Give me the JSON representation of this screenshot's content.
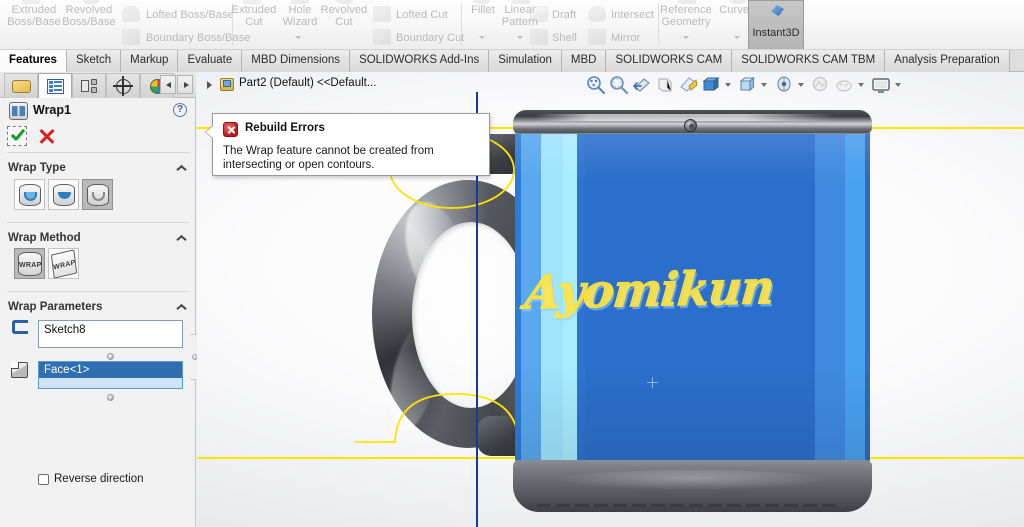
{
  "ribbon": {
    "groups": [
      {
        "name": "features-boss",
        "commands": [
          {
            "label": "Extruded\nBoss/Base",
            "icon": "extruded-boss-icon"
          },
          {
            "label": "Revolved\nBoss/Base",
            "icon": "revolved-boss-icon"
          },
          {
            "label": "Lofted Boss/Base",
            "icon": "lofted-boss-icon"
          },
          {
            "label": "Boundary Boss/Base",
            "icon": "boundary-boss-icon"
          }
        ]
      },
      {
        "name": "features-cut",
        "commands": [
          {
            "label": "Extruded\nCut",
            "icon": "extruded-cut-icon"
          },
          {
            "label": "Hole\nWizard",
            "icon": "hole-wizard-icon"
          },
          {
            "label": "Revolved\nCut",
            "icon": "revolved-cut-icon"
          },
          {
            "label": "Lofted Cut",
            "icon": "lofted-cut-icon"
          },
          {
            "label": "Boundary Cut",
            "icon": "boundary-cut-icon"
          }
        ]
      },
      {
        "name": "features-modify",
        "commands": [
          {
            "label": "Fillet",
            "icon": "fillet-icon"
          },
          {
            "label": "Linear\nPattern",
            "icon": "linear-pattern-icon"
          },
          {
            "label": "Draft",
            "icon": "draft-icon"
          },
          {
            "label": "Intersect",
            "icon": "intersect-icon"
          },
          {
            "label": "Shell",
            "icon": "shell-icon"
          },
          {
            "label": "Mirror",
            "icon": "mirror-icon"
          }
        ]
      },
      {
        "name": "features-reference",
        "commands": [
          {
            "label": "Reference\nGeometry",
            "icon": "reference-geometry-icon"
          },
          {
            "label": "Curves",
            "icon": "curves-icon"
          }
        ]
      }
    ],
    "instant3d": {
      "label": "Instant3D",
      "icon": "instant3d-icon",
      "active": true
    }
  },
  "ribbon_labels": {
    "extruded_boss_l1": "Extruded",
    "extruded_boss_l2": "Boss/Base",
    "revolved_boss_l1": "Revolved",
    "revolved_boss_l2": "Boss/Base",
    "lofted_boss": "Lofted Boss/Base",
    "boundary_boss": "Boundary Boss/Base",
    "extruded_cut_l1": "Extruded",
    "extruded_cut_l2": "Cut",
    "hole_wizard_l1": "Hole",
    "hole_wizard_l2": "Wizard",
    "revolved_cut_l1": "Revolved",
    "revolved_cut_l2": "Cut",
    "lofted_cut": "Lofted Cut",
    "boundary_cut": "Boundary Cut",
    "fillet": "Fillet",
    "linear_pattern_l1": "Linear",
    "linear_pattern_l2": "Pattern",
    "draft": "Draft",
    "intersect": "Intersect",
    "shell": "Shell",
    "mirror": "Mirror",
    "reference_geometry_l1": "Reference",
    "reference_geometry_l2": "Geometry",
    "curves": "Curves",
    "instant3d": "Instant3D"
  },
  "tabs": [
    {
      "label": "Features",
      "active": true
    },
    {
      "label": "Sketch",
      "active": false
    },
    {
      "label": "Markup",
      "active": false
    },
    {
      "label": "Evaluate",
      "active": false
    },
    {
      "label": "MBD Dimensions",
      "active": false
    },
    {
      "label": "SOLIDWORKS Add-Ins",
      "active": false
    },
    {
      "label": "Simulation",
      "active": false
    },
    {
      "label": "MBD",
      "active": false
    },
    {
      "label": "SOLIDWORKS CAM",
      "active": false
    },
    {
      "label": "SOLIDWORKS CAM TBM",
      "active": false
    },
    {
      "label": "Analysis Preparation",
      "active": false
    }
  ],
  "property_manager": {
    "tabs": [
      {
        "name": "feature-manager-design-tree-tab",
        "icon": "feature-tree-icon",
        "selected": false
      },
      {
        "name": "property-manager-tab",
        "icon": "property-manager-icon",
        "selected": true
      },
      {
        "name": "configuration-manager-tab",
        "icon": "configuration-manager-icon",
        "selected": false
      },
      {
        "name": "dimxpert-manager-tab",
        "icon": "dimxpert-icon",
        "selected": false
      },
      {
        "name": "display-manager-tab",
        "icon": "display-manager-icon",
        "selected": false
      }
    ],
    "nav": {
      "prev": "◄",
      "next": "►"
    },
    "title": "Wrap1",
    "title_icon": "wrap-feature-icon",
    "help_icon": "help-icon",
    "help_glyph": "?",
    "ok_label": "OK",
    "cancel_label": "Cancel",
    "sections": {
      "wrap_type": {
        "title": "Wrap Type",
        "options": [
          {
            "name": "emboss",
            "selected": false
          },
          {
            "name": "deboss",
            "selected": false
          },
          {
            "name": "scribe",
            "selected": true
          }
        ]
      },
      "wrap_method": {
        "title": "Wrap Method",
        "options": [
          {
            "name": "analytical",
            "label": "WRAP",
            "selected": true
          },
          {
            "name": "spline-surface",
            "label": "WRAP",
            "selected": false
          }
        ]
      },
      "wrap_parameters": {
        "title": "Wrap Parameters",
        "sketch_field": {
          "value": "Sketch8",
          "icon": "sketch-selection-icon"
        },
        "face_field": {
          "value": "Face<1>",
          "icon": "face-selection-icon",
          "selected": true
        },
        "reverse_direction": {
          "label": "Reverse direction",
          "checked": false
        }
      }
    }
  },
  "graphics": {
    "feature_tree_label": "Part2 (Default) <<Default...",
    "feature_tree_icon": "part-icon",
    "view_toolbar": [
      {
        "name": "zoom-to-fit-icon",
        "has_dropdown": false
      },
      {
        "name": "zoom-to-area-icon",
        "has_dropdown": false
      },
      {
        "name": "previous-view-icon",
        "has_dropdown": false
      },
      {
        "name": "section-view-icon",
        "has_dropdown": false
      },
      {
        "name": "view-orientation-icon",
        "has_dropdown": false
      },
      {
        "name": "display-style-icon",
        "has_dropdown": true
      },
      {
        "name": "hide-show-items-icon",
        "has_dropdown": true
      },
      {
        "name": "edit-appearance-icon",
        "has_dropdown": true
      },
      {
        "name": "apply-scene-icon",
        "has_dropdown": false
      },
      {
        "name": "view-settings-icon",
        "has_dropdown": true
      },
      {
        "name": "display-viewport-icon",
        "has_dropdown": true
      }
    ],
    "model": {
      "name": "coffee-mug",
      "wrap_text": "Ayomikun",
      "body_color": "#2a6fcc",
      "highlight_color": "#a9ecff",
      "handle_color": "#4b4e54",
      "sketch_color": "#ffe400",
      "axis_color": "#17389c"
    }
  },
  "error_dialog": {
    "icon": "error-icon",
    "title": "Rebuild Errors",
    "message": "The Wrap feature cannot be created from intersecting or open contours."
  }
}
